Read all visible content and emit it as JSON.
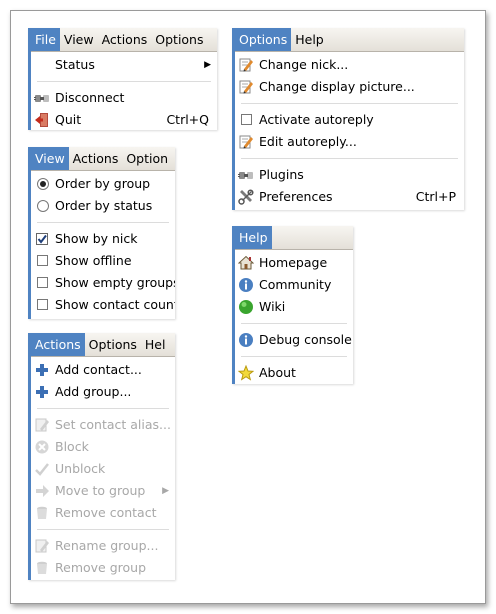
{
  "file_menu": {
    "bar": [
      "File",
      "View",
      "Actions",
      "Options"
    ],
    "status": "Status",
    "disconnect": "Disconnect",
    "quit": "Quit",
    "quit_shortcut": "Ctrl+Q"
  },
  "view_menu": {
    "bar": [
      "View",
      "Actions",
      "Option"
    ],
    "order_group": "Order by group",
    "order_status": "Order by status",
    "show_nick": "Show by nick",
    "show_offline": "Show offline",
    "show_empty": "Show empty groups",
    "show_count": "Show contact count"
  },
  "actions_menu": {
    "bar": [
      "Actions",
      "Options",
      "Hel"
    ],
    "add_contact": "Add contact...",
    "add_group": "Add group...",
    "set_alias": "Set contact alias...",
    "block": "Block",
    "unblock": "Unblock",
    "move_group": "Move to group",
    "remove_contact": "Remove contact",
    "rename_group": "Rename group...",
    "remove_group": "Remove group"
  },
  "options_menu": {
    "bar": [
      "Options",
      "Help"
    ],
    "change_nick": "Change nick...",
    "change_picture": "Change display picture...",
    "activate_autoreply": "Activate autoreply",
    "edit_autoreply": "Edit autoreply...",
    "plugins": "Plugins",
    "preferences": "Preferences",
    "preferences_shortcut": "Ctrl+P"
  },
  "help_menu": {
    "bar": [
      "Help"
    ],
    "homepage": "Homepage",
    "community": "Community",
    "wiki": "Wiki",
    "debug_console": "Debug console",
    "about": "About"
  },
  "colors": {
    "accent": "#4f83c2",
    "disabled": "#a8a8a8"
  },
  "state": {
    "order_by_group": true,
    "show_by_nick": true,
    "show_offline": false,
    "show_empty_groups": false,
    "show_contact_count": false,
    "activate_autoreply": false
  }
}
